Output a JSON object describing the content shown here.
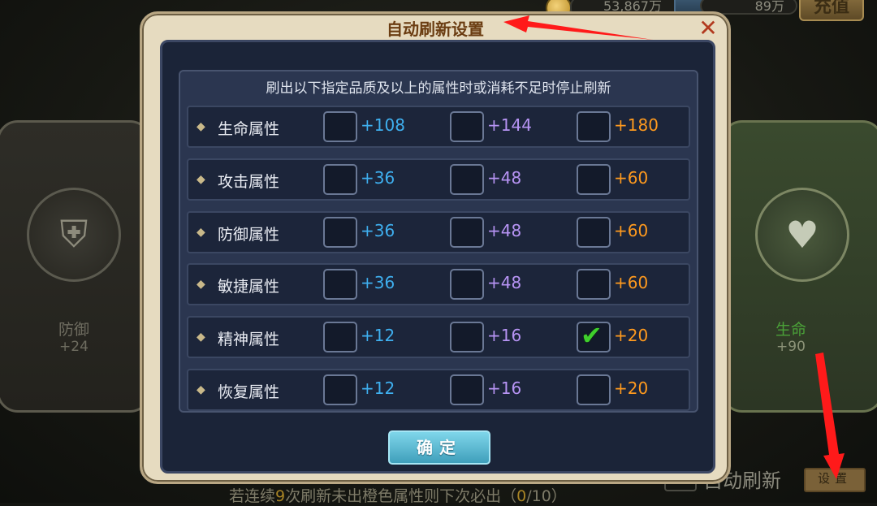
{
  "topbar": {
    "gold": "53,867万",
    "gems": "89万",
    "recharge_label": "充值"
  },
  "cards": {
    "left": {
      "name": "防御",
      "value": "+24"
    },
    "right": {
      "name": "生命",
      "value": "+90"
    }
  },
  "dialog": {
    "title": "自动刷新设置",
    "close": "✕",
    "header": "刷出以下指定品质及以上的属性时或消耗不足时停止刷新",
    "rows": [
      {
        "label": "生命属性",
        "options": [
          {
            "value": "+108",
            "checked": false
          },
          {
            "value": "+144",
            "checked": false
          },
          {
            "value": "+180",
            "checked": false
          }
        ]
      },
      {
        "label": "攻击属性",
        "options": [
          {
            "value": "+36",
            "checked": false
          },
          {
            "value": "+48",
            "checked": false
          },
          {
            "value": "+60",
            "checked": false
          }
        ]
      },
      {
        "label": "防御属性",
        "options": [
          {
            "value": "+36",
            "checked": false
          },
          {
            "value": "+48",
            "checked": false
          },
          {
            "value": "+60",
            "checked": false
          }
        ]
      },
      {
        "label": "敏捷属性",
        "options": [
          {
            "value": "+36",
            "checked": false
          },
          {
            "value": "+48",
            "checked": false
          },
          {
            "value": "+60",
            "checked": false
          }
        ]
      },
      {
        "label": "精神属性",
        "options": [
          {
            "value": "+12",
            "checked": false
          },
          {
            "value": "+16",
            "checked": false
          },
          {
            "value": "+20",
            "checked": true
          }
        ]
      },
      {
        "label": "恢复属性",
        "options": [
          {
            "value": "+12",
            "checked": false
          },
          {
            "value": "+16",
            "checked": false
          },
          {
            "value": "+20",
            "checked": false
          }
        ]
      }
    ],
    "confirm_label": "确定"
  },
  "footer": {
    "auto_refresh_label": "自动刷新",
    "settings_label": "设置",
    "hint_pre": "若连续",
    "hint_count": "9",
    "hint_mid": "次刷新未出橙色属性则下次必出（",
    "hint_progress": "0",
    "hint_post": "/10）"
  },
  "colors": {
    "tier1": "#3fb0f0",
    "tier2": "#b794f4",
    "tier3": "#ff9a1e",
    "check": "#3fcf2c",
    "annotation": "#ff1a1a"
  }
}
